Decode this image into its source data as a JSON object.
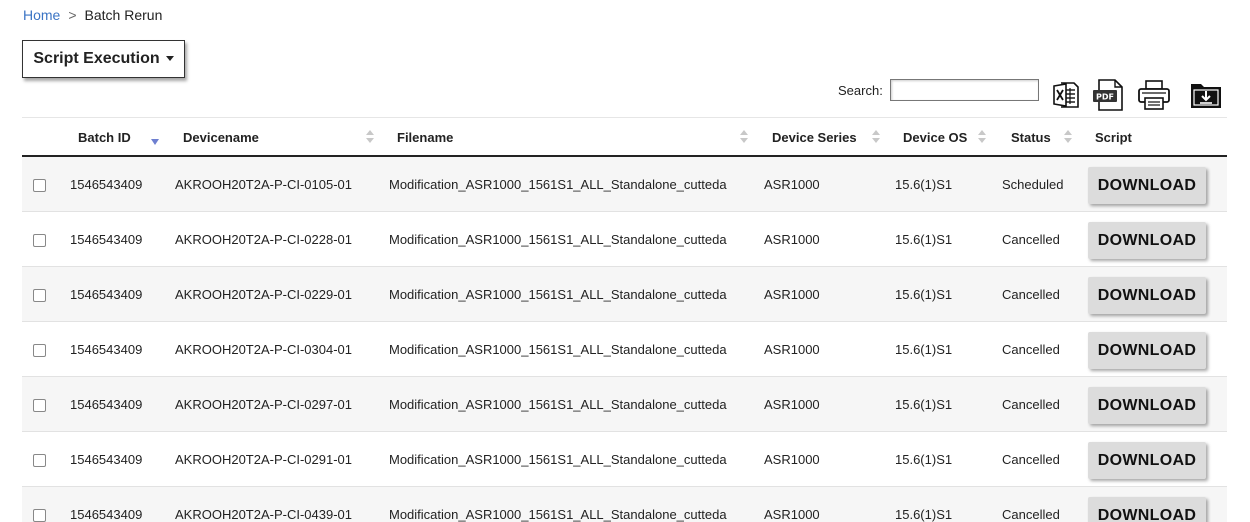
{
  "breadcrumb": {
    "home": "Home",
    "separator": ">",
    "current": "Batch Rerun"
  },
  "script_button": {
    "label": "Script Execution"
  },
  "search": {
    "label": "Search:",
    "value": ""
  },
  "toolbar": {
    "icons": [
      "excel-icon",
      "pdf-icon",
      "print-icon",
      "download-folder-icon"
    ]
  },
  "table": {
    "columns": [
      "Batch ID",
      "Devicename",
      "Filename",
      "Device Series",
      "Device OS",
      "Status",
      "Script"
    ],
    "rows": [
      {
        "batch_id": "1546543409",
        "device": "AKROOH20T2A-P-CI-0105-01",
        "file": "Modification_ASR1000_1561S1_ALL_Standalone_cutteda",
        "series": "ASR1000",
        "os": "15.6(1)S1",
        "status": "Scheduled",
        "action": "DOWNLOAD"
      },
      {
        "batch_id": "1546543409",
        "device": "AKROOH20T2A-P-CI-0228-01",
        "file": "Modification_ASR1000_1561S1_ALL_Standalone_cutteda",
        "series": "ASR1000",
        "os": "15.6(1)S1",
        "status": "Cancelled",
        "action": "DOWNLOAD"
      },
      {
        "batch_id": "1546543409",
        "device": "AKROOH20T2A-P-CI-0229-01",
        "file": "Modification_ASR1000_1561S1_ALL_Standalone_cutteda",
        "series": "ASR1000",
        "os": "15.6(1)S1",
        "status": "Cancelled",
        "action": "DOWNLOAD"
      },
      {
        "batch_id": "1546543409",
        "device": "AKROOH20T2A-P-CI-0304-01",
        "file": "Modification_ASR1000_1561S1_ALL_Standalone_cutteda",
        "series": "ASR1000",
        "os": "15.6(1)S1",
        "status": "Cancelled",
        "action": "DOWNLOAD"
      },
      {
        "batch_id": "1546543409",
        "device": "AKROOH20T2A-P-CI-0297-01",
        "file": "Modification_ASR1000_1561S1_ALL_Standalone_cutteda",
        "series": "ASR1000",
        "os": "15.6(1)S1",
        "status": "Cancelled",
        "action": "DOWNLOAD"
      },
      {
        "batch_id": "1546543409",
        "device": "AKROOH20T2A-P-CI-0291-01",
        "file": "Modification_ASR1000_1561S1_ALL_Standalone_cutteda",
        "series": "ASR1000",
        "os": "15.6(1)S1",
        "status": "Cancelled",
        "action": "DOWNLOAD"
      },
      {
        "batch_id": "1546543409",
        "device": "AKROOH20T2A-P-CI-0439-01",
        "file": "Modification_ASR1000_1561S1_ALL_Standalone_cutteda",
        "series": "ASR1000",
        "os": "15.6(1)S1",
        "status": "Cancelled",
        "action": "DOWNLOAD"
      }
    ]
  }
}
